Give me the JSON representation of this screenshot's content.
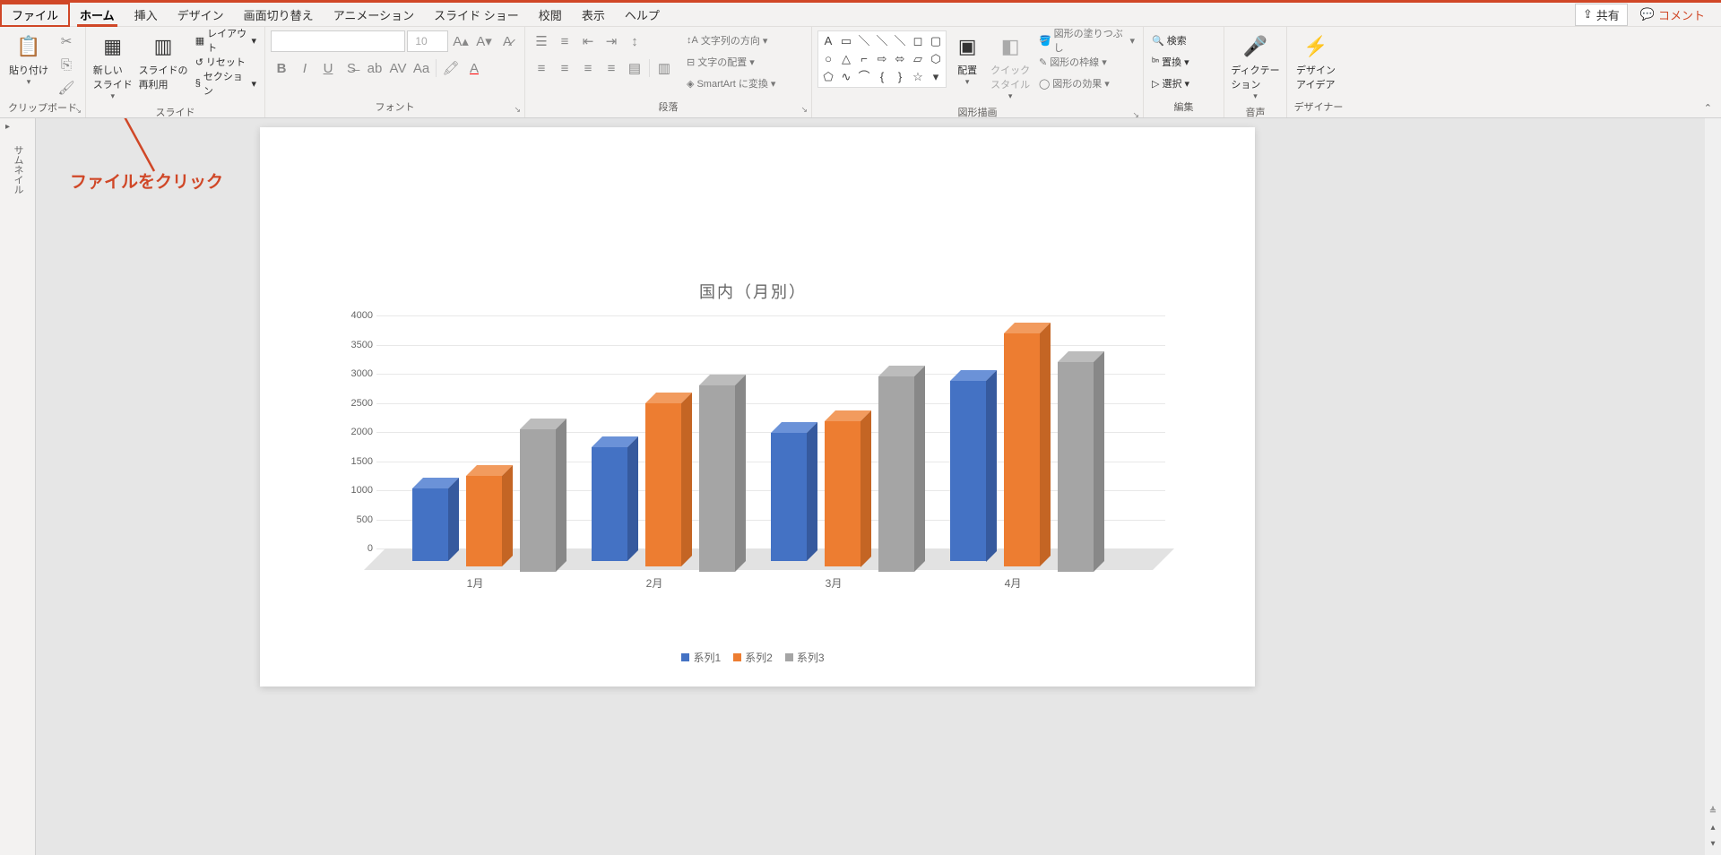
{
  "tabs": {
    "file": "ファイル",
    "home": "ホーム",
    "insert": "挿入",
    "design": "デザイン",
    "transitions": "画面切り替え",
    "animations": "アニメーション",
    "slideshow": "スライド ショー",
    "review": "校閲",
    "view": "表示",
    "help": "ヘルプ"
  },
  "topright": {
    "share": "共有",
    "comment": "コメント"
  },
  "ribbon": {
    "clipboard": {
      "label": "クリップボード",
      "paste": "貼り付け"
    },
    "slides": {
      "label": "スライド",
      "new_slide": "新しい\nスライド",
      "reuse": "スライドの\n再利用",
      "layout": "レイアウト",
      "reset": "リセット",
      "section": "セクション"
    },
    "font": {
      "label": "フォント",
      "size": "10"
    },
    "paragraph": {
      "label": "段落",
      "direction": "文字列の方向",
      "align": "文字の配置",
      "smartart": "SmartArt に変換"
    },
    "drawing": {
      "label": "図形描画",
      "arrange": "配置",
      "quickstyle": "クイック\nスタイル",
      "fill": "図形の塗りつぶし",
      "outline": "図形の枠線",
      "effects": "図形の効果"
    },
    "editing": {
      "label": "編集",
      "find": "検索",
      "replace": "置換",
      "select": "選択"
    },
    "voice": {
      "label": "音声",
      "dictate": "ディクテー\nション"
    },
    "designer": {
      "label": "デザイナー",
      "ideas": "デザイン\nアイデア"
    }
  },
  "thumbnail_label": "サムネイル",
  "annotation": "ファイルをクリック",
  "chart_data": {
    "type": "bar",
    "title": "国内（月別）",
    "categories": [
      "1月",
      "2月",
      "3月",
      "4月"
    ],
    "series": [
      {
        "name": "系列1",
        "values": [
          1250,
          1950,
          2200,
          3100
        ]
      },
      {
        "name": "系列2",
        "values": [
          1550,
          2800,
          2500,
          4000
        ]
      },
      {
        "name": "系列3",
        "values": [
          2450,
          3200,
          3350,
          3600
        ]
      }
    ],
    "ylim": [
      0,
      4000
    ],
    "ytick_step": 500
  }
}
